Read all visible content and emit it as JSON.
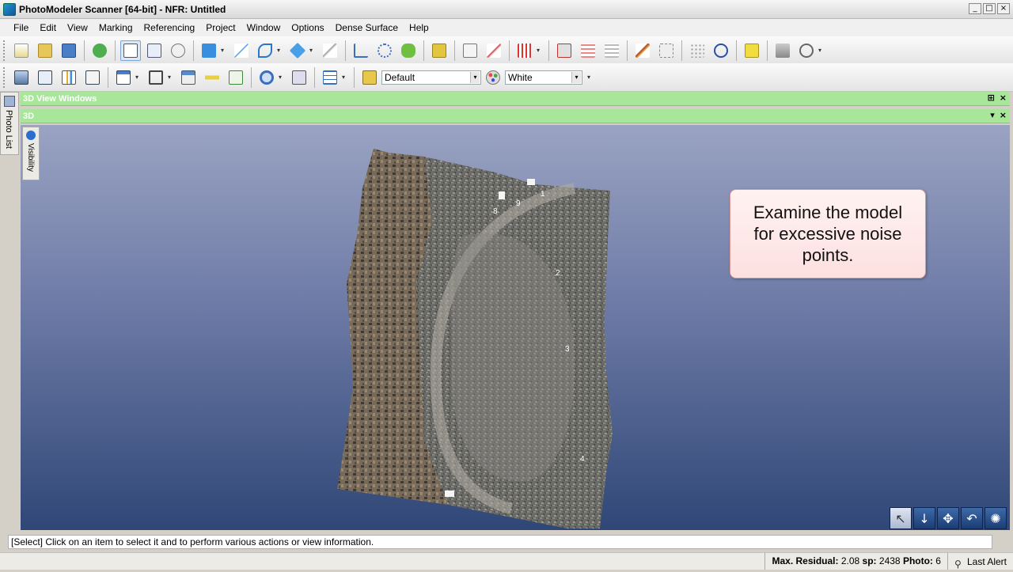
{
  "window": {
    "title": "PhotoModeler Scanner [64-bit] - NFR: Untitled",
    "controls": [
      "_",
      "□",
      "×"
    ]
  },
  "menu": [
    "File",
    "Edit",
    "View",
    "Marking",
    "Referencing",
    "Project",
    "Window",
    "Options",
    "Dense Surface",
    "Help"
  ],
  "toolbar2": {
    "combo1_value": "Default",
    "combo2_value": "White"
  },
  "side_tab": {
    "label": "Photo List"
  },
  "panels": {
    "windows_title": "3D View Windows",
    "view_title": "3D",
    "pin": "⊞",
    "close": "×",
    "dropdown": "▾"
  },
  "visibility_tab": {
    "label": "Visibility"
  },
  "callout": {
    "text": "Examine the model for excessive noise points."
  },
  "status_line": "[Select] Click on an item to select it and to perform various actions or view information.",
  "status_bar": {
    "residual_label": "Max. Residual:",
    "residual_value": "2.08",
    "sp_label": "sp:",
    "sp_value": "2438",
    "photo_label": "Photo:",
    "photo_value": "6",
    "alert": "Last Alert"
  },
  "model_point_labels": [
    "1",
    "2",
    "3",
    "4",
    "8",
    "9"
  ],
  "icons": {
    "toolbar1": [
      "new-project-icon",
      "open-icon",
      "save-icon",
      "undo-icon",
      "select-icon",
      "select-multiple-icon",
      "delete-icon",
      "add-point-icon",
      "line-icon",
      "curve-icon",
      "shape-icon",
      "ruler-icon",
      "edge-icon",
      "reference-icon",
      "link-icon",
      "measure-icon",
      "checklist-icon",
      "pin-icon",
      "grid-icon",
      "marking-icon",
      "dense-grid-icon",
      "grid2-icon",
      "pencil-icon",
      "text-icon",
      "dots-icon",
      "no-icon",
      "yellow-icon",
      "layers-icon",
      "camera-icon"
    ],
    "toolbar2": [
      "photo-view-icon",
      "zoom-view-icon",
      "chart-icon",
      "check-icon",
      "table-icon",
      "box-icon",
      "panel-icon",
      "tape-icon",
      "verify-icon",
      "magnifier-icon",
      "fit-icon",
      "grid-view-icon",
      "paint-icon",
      "palette-icon"
    ]
  },
  "nav_buttons": [
    "cursor-icon",
    "down-arrow-icon",
    "move-icon",
    "rotate-icon",
    "settings-icon"
  ]
}
